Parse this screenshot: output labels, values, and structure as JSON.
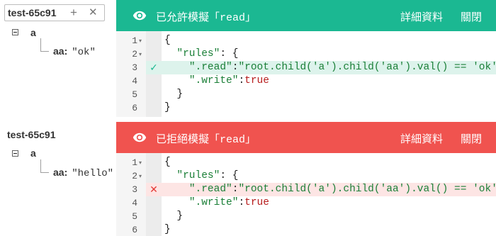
{
  "simulations": [
    {
      "tree": {
        "title": "test-65c91",
        "title_in_box": true,
        "add_icon": "plus-icon",
        "close_icon": "close-icon",
        "node": "a",
        "leaf_key": "aa:",
        "leaf_value": "\"ok\""
      },
      "banner": {
        "status": "allow",
        "color": "#1bb892",
        "icon": "eye-icon",
        "title_prefix": "已允許模擬「",
        "title_op": "read",
        "title_suffix": "」",
        "details_label": "詳細資料",
        "close_label": "關閉"
      },
      "editor": {
        "highlight_line": 3,
        "highlight_mark": "✓",
        "lines": [
          {
            "num": "1",
            "fold": "▾",
            "text": "{"
          },
          {
            "num": "2",
            "fold": "▾",
            "text": "  \"rules\": {"
          },
          {
            "num": "3",
            "fold": "",
            "text": "    \".read\":\"root.child('a').child('aa').val() == 'ok'\","
          },
          {
            "num": "4",
            "fold": "",
            "text": "    \".write\":true"
          },
          {
            "num": "5",
            "fold": "",
            "text": "  }"
          },
          {
            "num": "6",
            "fold": "",
            "text": "}"
          }
        ]
      }
    },
    {
      "tree": {
        "title": "test-65c91",
        "title_in_box": false,
        "node": "a",
        "leaf_key": "aa:",
        "leaf_value": "\"hello\""
      },
      "banner": {
        "status": "deny",
        "color": "#f0534f",
        "icon": "eye-icon",
        "title_prefix": "已拒絕模擬「",
        "title_op": "read",
        "title_suffix": "」",
        "details_label": "詳細資料",
        "close_label": "關閉"
      },
      "editor": {
        "highlight_line": 3,
        "highlight_mark": "✕",
        "lines": [
          {
            "num": "1",
            "fold": "▾",
            "text": "{"
          },
          {
            "num": "2",
            "fold": "▾",
            "text": "  \"rules\": {"
          },
          {
            "num": "3",
            "fold": "",
            "text": "    \".read\":\"root.child('a').child('aa').val() == 'ok'\","
          },
          {
            "num": "4",
            "fold": "",
            "text": "    \".write\":true"
          },
          {
            "num": "5",
            "fold": "",
            "text": "  }"
          },
          {
            "num": "6",
            "fold": "",
            "text": "}"
          }
        ]
      }
    }
  ]
}
